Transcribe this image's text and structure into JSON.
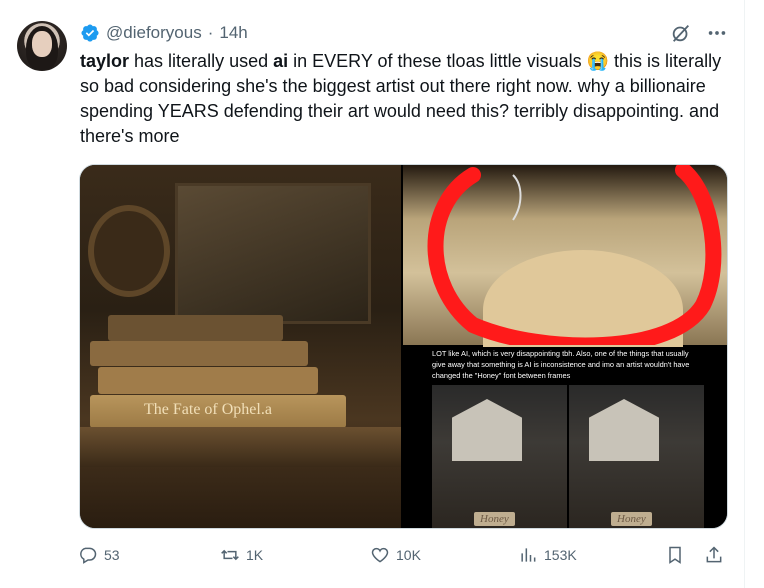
{
  "author": {
    "handle": "@dieforyous",
    "separator": "·",
    "time": "14h",
    "verified": true,
    "avatar_icon": "profile-photo"
  },
  "tweet": {
    "name_bold": "taylor",
    "part1": " has literally used ",
    "ai_bold": "ai",
    "part2": " in EVERY of these tloas little visuals ",
    "emoji": "😭",
    "part3": " this is literally so bad considering she's the biggest artist out there right now. why a billionaire spending YEARS defending their art would need this? terribly disappointing. and there's more"
  },
  "media": {
    "left_book_title": "The Fate of Ophel.a",
    "bottom_right_caption": "LOT like AI, which is very disappointing tbh. Also, one of the things that usually give away that something is AI is inconsistence and imo an artist wouldn't have changed the \"Honey\" font between frames",
    "honey_label_1": "Honey",
    "honey_label_2": "Honey"
  },
  "actions": {
    "replies": "53",
    "retweets": "1K",
    "likes": "10K",
    "views": "153K"
  },
  "colors": {
    "accent": "#1d9bf0",
    "muted": "#536471",
    "text": "#0f1419"
  }
}
